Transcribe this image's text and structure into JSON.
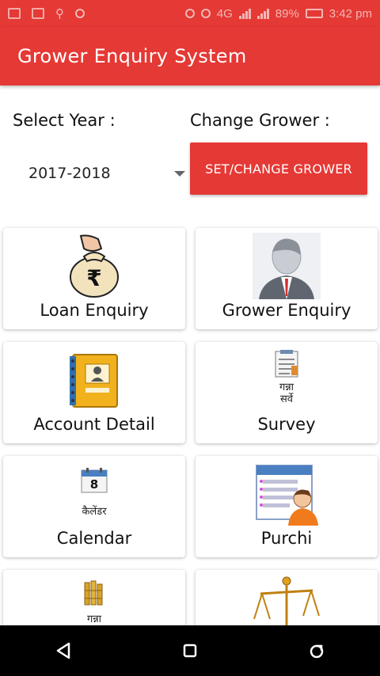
{
  "status_bar": {
    "battery": "89%",
    "time": "3:42 pm",
    "network": "4G"
  },
  "app_bar": {
    "title": "Grower Enquiry System"
  },
  "filters": {
    "year_label": "Select Year :",
    "year_value": "2017-2018",
    "grower_label": "Change Grower :",
    "set_button": "SET/CHANGE GROWER"
  },
  "menu": {
    "items": [
      {
        "label": "Loan Enquiry",
        "icon": "money-bag-icon"
      },
      {
        "label": "Grower Enquiry",
        "icon": "person-icon"
      },
      {
        "label": "Account Detail",
        "icon": "address-book-icon"
      },
      {
        "label": "Survey",
        "icon": "survey-icon",
        "icon_text": [
          "गन्ना",
          "सर्वे"
        ]
      },
      {
        "label": "Calendar",
        "icon": "calendar-icon",
        "icon_text": [
          "कैलेंडर"
        ],
        "calendar_day": "8"
      },
      {
        "label": "Purchi",
        "icon": "purchi-icon"
      },
      {
        "label": "",
        "icon": "sugarcane-icon",
        "icon_text": [
          "गन्ना"
        ]
      },
      {
        "label": "",
        "icon": "scale-icon"
      }
    ]
  },
  "colors": {
    "primary": "#e53935"
  }
}
